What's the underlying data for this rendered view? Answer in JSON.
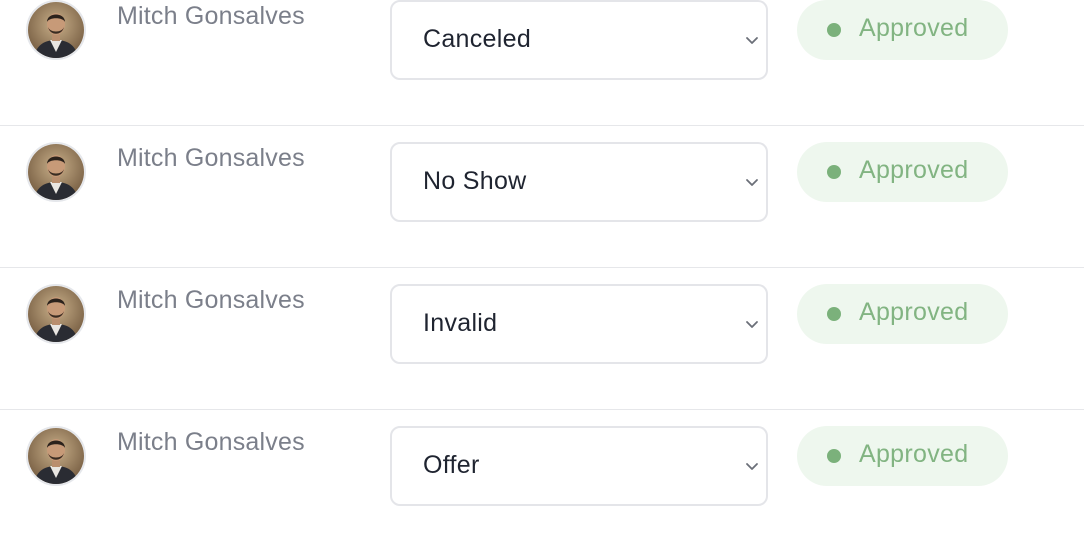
{
  "colors": {
    "name_text": "#7b7f8a",
    "select_text": "#1f2430",
    "select_border": "#e4e5e9",
    "badge_bg": "#eef7ee",
    "badge_dot": "#7bb17b",
    "badge_text": "#82b482",
    "divider": "#e6e7ea"
  },
  "rows": [
    {
      "name": "Mitch Gonsalves",
      "avatar_icon": "user-avatar-photo",
      "status_select": "Canceled",
      "select_icon": "chevron-down-icon",
      "approval_badge": "Approved"
    },
    {
      "name": "Mitch Gonsalves",
      "avatar_icon": "user-avatar-photo",
      "status_select": "No Show",
      "select_icon": "chevron-down-icon",
      "approval_badge": "Approved"
    },
    {
      "name": "Mitch Gonsalves",
      "avatar_icon": "user-avatar-photo",
      "status_select": "Invalid",
      "select_icon": "chevron-down-icon",
      "approval_badge": "Approved"
    },
    {
      "name": "Mitch Gonsalves",
      "avatar_icon": "user-avatar-photo",
      "status_select": "Offer",
      "select_icon": "chevron-down-icon",
      "approval_badge": "Approved"
    }
  ]
}
